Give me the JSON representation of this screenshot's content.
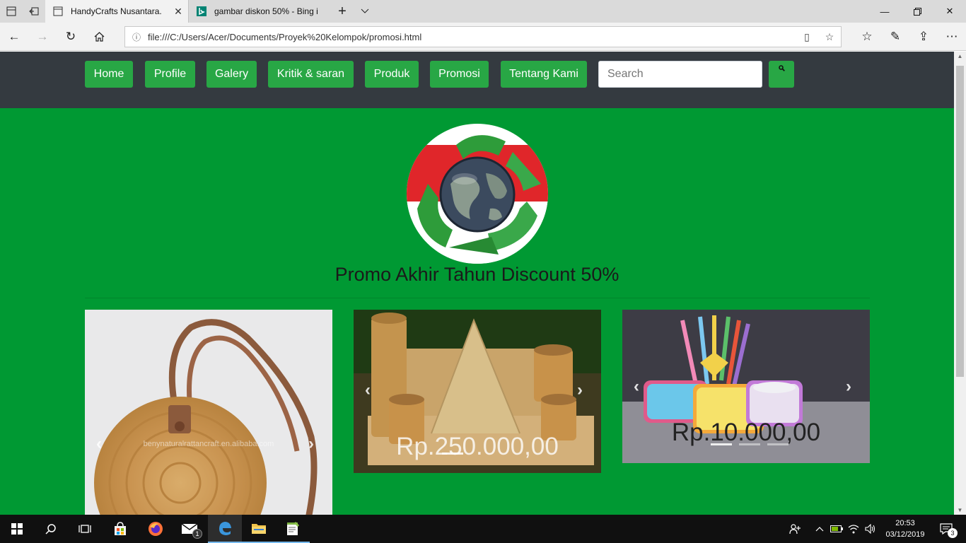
{
  "browser": {
    "tabs": [
      {
        "title": "HandyCrafts Nusantara."
      },
      {
        "title": "gambar diskon 50% - Bing i"
      }
    ],
    "url": "file:///C:/Users/Acer/Documents/Proyek%20Kelompok/promosi.html"
  },
  "navbar": {
    "items": [
      {
        "label": "Home"
      },
      {
        "label": "Profile"
      },
      {
        "label": "Galery"
      },
      {
        "label": "Kritik & saran"
      },
      {
        "label": "Produk"
      },
      {
        "label": "Promosi"
      },
      {
        "label": "Tentang Kami"
      }
    ],
    "search_placeholder": "Search"
  },
  "main": {
    "title": "Promo Akhir Tahun Discount 50%",
    "cards": [
      {
        "price": "",
        "watermark": "benynaturalrattancraft.en.alibaba.com"
      },
      {
        "price": "Rp.250.000,00"
      },
      {
        "price": "Rp.10.000,00"
      }
    ]
  },
  "taskbar": {
    "time": "20:53",
    "date": "03/12/2019",
    "mail_badge": "1",
    "notification_count": "3"
  },
  "colors": {
    "page_bg": "#009933",
    "navbar_bg": "#343a40",
    "button_green": "#28a745"
  }
}
